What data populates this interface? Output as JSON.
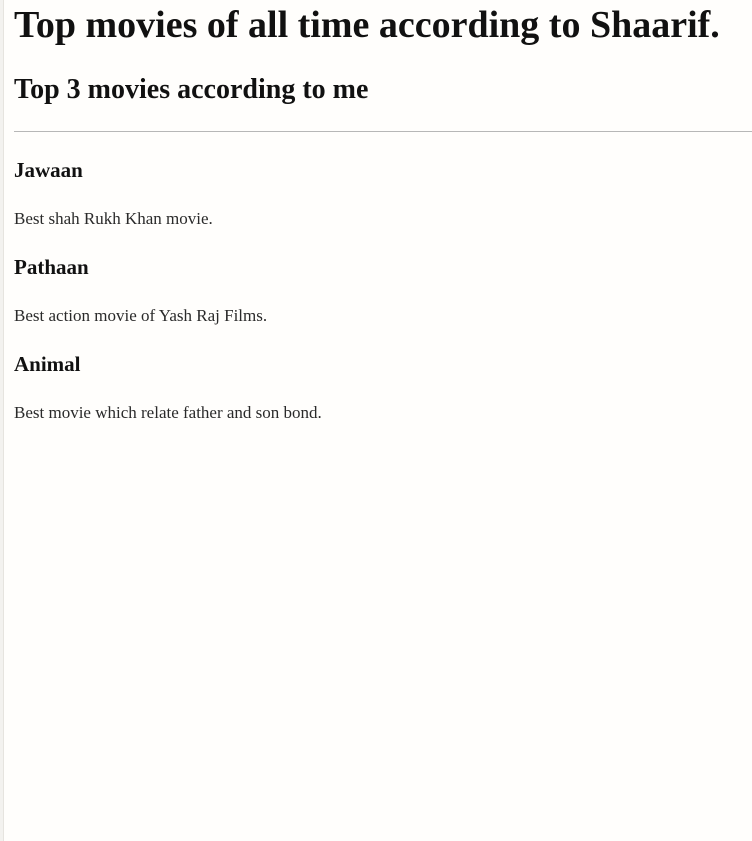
{
  "page": {
    "title": "Top movies of all time according to Shaarif.",
    "subtitle": "Top 3 movies according to me"
  },
  "movies": [
    {
      "title": "Jawaan",
      "description": "Best shah Rukh Khan movie."
    },
    {
      "title": "Pathaan",
      "description": "Best action movie of Yash Raj Films."
    },
    {
      "title": "Animal",
      "description": "Best movie which relate father and son bond."
    }
  ],
  "colors": {
    "background": "#fffefc",
    "text": "#111111",
    "rule": "#b7b7b7"
  }
}
